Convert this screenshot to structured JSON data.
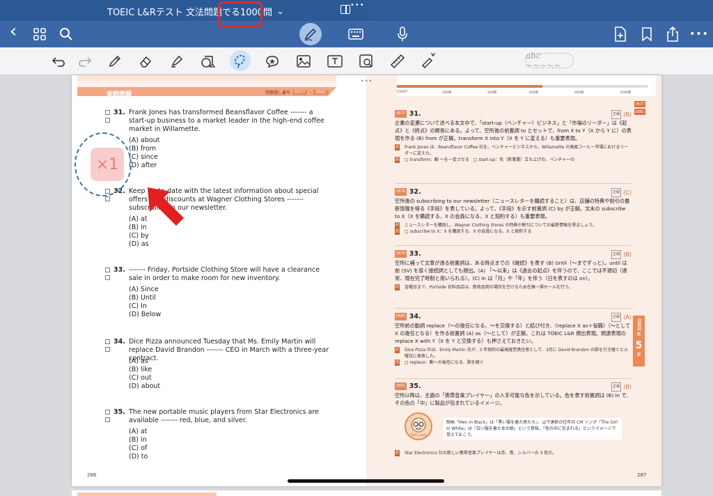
{
  "app": {
    "title": "TOEIC L&Rテスト 文法問題でる1000問",
    "title_chevron": "⌄",
    "dots": "•••"
  },
  "nav": {
    "back": "‹",
    "grid": "⊞",
    "search": "⌕",
    "more": "•••"
  },
  "toolbar": {
    "handwriting_placeholder": "abc ~~~~~"
  },
  "colors": {
    "title_bar": "#2b5a97",
    "nav_bar": "#3b67a7",
    "highlight_box": "#e02b2b",
    "lasso_annotation": "#2d74b7",
    "accent_orange": "#e7885a"
  },
  "left_page": {
    "banner_label": "実戦問題",
    "banner_range_label": "問題通し番号",
    "banner_range_start": "0577",
    "banner_range_end": "0581",
    "page_number": "286",
    "questions": [
      {
        "num": "31.",
        "stem": "Frank Jones has transformed Beansflavor Coffee ------- a start-up business to a market leader in the high-end coffee market in Willamette.",
        "options": [
          "(A) about",
          "(B) from",
          "(C) since",
          "(D) after"
        ]
      },
      {
        "num": "32.",
        "stem": "Keep up-to-date with the latest information about special offers and discounts at Wagner Clothing Stores ------- subscribing to our newsletter.",
        "options": [
          "(A) at",
          "(B) in",
          "(C) by",
          "(D) as"
        ]
      },
      {
        "num": "33.",
        "stem": "------- Friday, Portside Clothing Store will have a clearance sale in order to make room for new inventory.",
        "options": [
          "(A) Since",
          "(B) Until",
          "(C) In",
          "(D) Below"
        ]
      },
      {
        "num": "34.",
        "stem": "Dice Pizza announced Tuesday that Ms. Emily Martin will replace David Brandon ------- CEO in March with a three-year contract.",
        "options": [
          "(A) as",
          "(B) like",
          "(C) out",
          "(D) about"
        ]
      },
      {
        "num": "35.",
        "stem": "The new portable music players from Star Electronics are available ------- red, blue, and silver.",
        "options": [
          "(A) at",
          "(B) in",
          "(C) of",
          "(D) to"
        ]
      }
    ]
  },
  "right_page": {
    "page_number": "287",
    "progress_ticks": [
      "START!",
      "200問",
      "400問",
      "600問",
      "800問",
      "1000問"
    ],
    "progress_fraction": 0.58,
    "side_tabs": [
      "0577",
      "0581"
    ],
    "chapter_label": "前置詞",
    "chapter_marker": "第",
    "chapter_number": "5",
    "chapter_suffix": "章",
    "answers": [
      {
        "id": "0577",
        "num": "31.",
        "key": "(B)",
        "body": "企業の変遷について述べる本文中で、「start-up（ベンチャー）ビジネス」と「市場のリーダー」は《起点》と《終点》の関係にある。よって、空所後の前置詞 to とセットで、from X to Y（X から Y に）の表現を作る (B) from が正解。transform X into Y（X を Y に変える）も重要表現。",
        "translation": "Frank Jones は、Beansflavor Coffee 社を、ベンチャービジネスから、Willamette の高級コーヒー市場におけるリーダーに変えた。",
        "vocab": "□ transform：動 〜を一変させる　□ start-up：名（新事業）立ち上げの、ベンチャーの"
      },
      {
        "id": "0578",
        "num": "32.",
        "key": "(C)",
        "body": "空所後の subscribing to our newsletter（ニュースレターを購読すること）は、店舗の特典や割引の最新情報を得る《手段》を表している。よって、《手段》を示す前置詞 (C) by が正解。文末の subscribe to X（X を購読する、X の会員になる、X と契約する）も重要表現。",
        "translation": "ニュースレターを購読し、Wagner Clothing Stores の特典や割引についての最新情報を得ましょう。",
        "vocab": "□ subscribe to X：X を購読する、X の会員になる、X と契約する"
      },
      {
        "id": "0579",
        "num": "33.",
        "key": "(B)",
        "body": "空所に補って文章が通る前置詞は、ある時点までの《継続》を表す (B) Until（〜までずっと）。until は前 (SV) を導く接続詞としても頻出。(A) 「〜以来」は《過去の起点》を伴うので、ここでは不適切（通常、現在完了時制と用いられる）。(C) In は「月」や「年」を伴う（日を表すのは on）。",
        "translation": "金曜日まで、Portside 衣料品店は、新商品用の場所を空けるため在庫一掃セールを行う。",
        "vocab": ""
      },
      {
        "id": "0580",
        "num": "34.",
        "key": "(A)",
        "body": "空所前の動詞 replace（〜の後任になる、〜を交換する）と結び付き、〈replace X as＋役職〉（〜として X の後任となる）を作る前置詞 (A) as（〜として）が正解。これは TOEIC L&R 頻出表現。関連表現の replace X with Y（X を Y と交換する）も押さえておきたい。",
        "translation": "Dice Pizza 社は、Emily Martin 氏が、3 年契約の最高経営責任者として、3月に David Brandon の跡を引き継ぐと火曜日に発表した。",
        "vocab": "□ replace：動〜の後任になる、跡を継ぐ"
      },
      {
        "id": "0581",
        "num": "35.",
        "key": "(B)",
        "body": "空所以降は、主語の「携帯音楽プレイヤー」の入手可能な色を示している。色を表す前置詞は (B) in で、その色の「中」に製品が包まれているイメージ。",
        "translation": "Star Electronics 社の新しい携帯音楽プレイヤーは赤、青、シルバーの 3 色だ。",
        "vocab": ""
      }
    ],
    "tex_label": "TEX's notes",
    "tex_note": "映画『Men in Black』は「黒い服を着た男たち」、山下達郎の往年の CM ソング『The Girl In White』は「白い服を着た女の娘」という意味。「色の中に包まれる」というイメージで覚えておこう。"
  },
  "annotations": {
    "count_badge": "×1"
  }
}
